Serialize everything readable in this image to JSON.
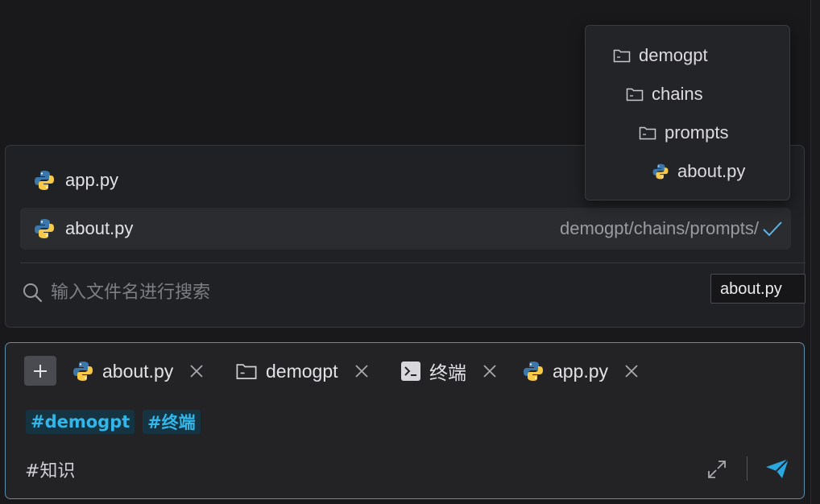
{
  "picker": {
    "results": [
      {
        "name": "app.py",
        "icon": "python-icon"
      },
      {
        "name": "about.py",
        "icon": "python-icon",
        "path": "demogpt/chains/prompts/",
        "selected": true
      }
    ],
    "search_placeholder": "输入文件名进行搜索"
  },
  "path_tooltip": {
    "items": [
      "demogpt",
      "chains",
      "prompts",
      "about.py"
    ]
  },
  "hover_tooltip": "about.py",
  "chat": {
    "chips": [
      {
        "label": "about.py",
        "icon": "python-icon"
      },
      {
        "label": "demogpt",
        "icon": "folder-icon"
      },
      {
        "label": "终端",
        "icon": "terminal-icon"
      },
      {
        "label": "app.py",
        "icon": "python-icon"
      }
    ],
    "tags": [
      "#demogpt",
      "#终端"
    ],
    "input_value": "#知识",
    "accent": "#33b7ea",
    "send_color": "#2aa7e0"
  }
}
